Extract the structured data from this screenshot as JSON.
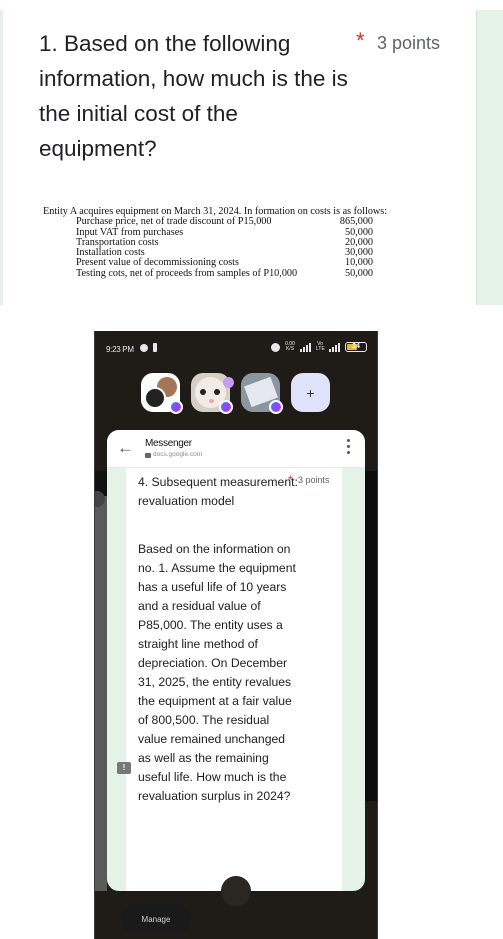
{
  "form_question_1": {
    "title": "1. Based on the following information, how much is the is the initial cost of the equipment?",
    "required_marker": "*",
    "points": "3 points",
    "info": {
      "intro": "Entity A acquires equipment on March 31, 2024. In formation on costs is as follows:",
      "rows": [
        {
          "label": "Purchase price, net of trade discount of P15,000",
          "value": "865,000"
        },
        {
          "label": "Input VAT from purchases",
          "value": "50,000"
        },
        {
          "label": "Transportation costs",
          "value": "20,000"
        },
        {
          "label": "Installation costs",
          "value": "30,000"
        },
        {
          "label": "Present value of decommissioning costs",
          "value": "10,000"
        },
        {
          "label": "Testing cots, net of proceeds from samples of P10,000",
          "value": "50,000"
        }
      ]
    }
  },
  "phone": {
    "status_bar": {
      "time": "9:23 PM",
      "net_speed": "0.00 K/S",
      "sim1": "4G+",
      "volte": "Vo LTE",
      "sim2": "4G+",
      "battery": "24"
    },
    "chat_heads": [
      {
        "name": "chat-head-1",
        "badge": "messenger"
      },
      {
        "name": "chat-head-2",
        "badge": "messenger",
        "unread_dot": true
      },
      {
        "name": "chat-head-3",
        "badge": "messenger"
      },
      {
        "name": "new-chat",
        "label": "+"
      }
    ],
    "browser": {
      "title": "Messenger",
      "url": "docs.google.com"
    },
    "form_question_4": {
      "title": "4. Subsequent measurement: revaluation model",
      "required_marker": "*",
      "points": "3 points",
      "body": "Based on the information on no. 1. Assume the equipment has a useful life of 10 years and a residual value of P85,000. The entity uses a straight line method of depreciation. On December 31, 2025, the entity revalues the equipment at a fair value of 800,500. The residual value remained unchanged as well as the remaining useful life. How much is the revaluation surplus in 2024?"
    },
    "manage_label": "Manage",
    "feedback_icon": "!"
  }
}
